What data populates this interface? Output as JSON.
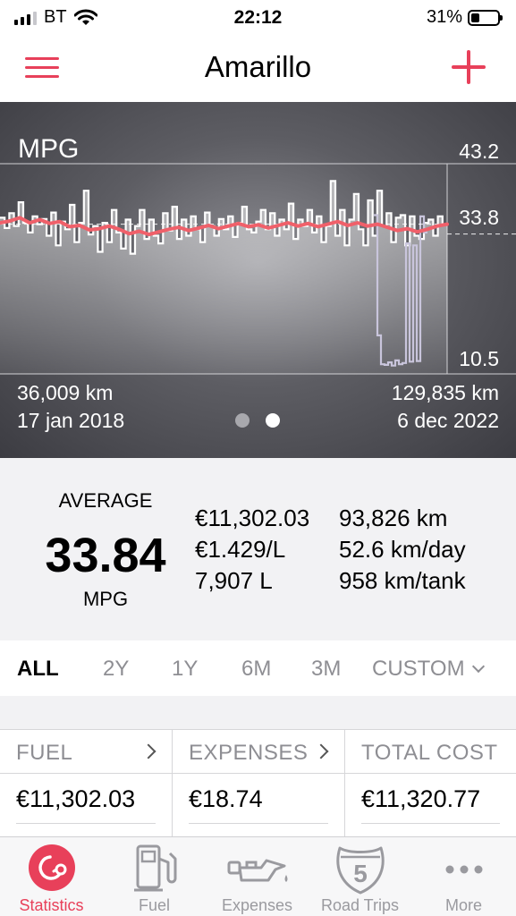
{
  "status_bar": {
    "carrier": "BT",
    "time": "22:12",
    "battery": "31%",
    "battery_level": 0.31
  },
  "navbar": {
    "title": "Amarillo"
  },
  "chart_data": {
    "type": "line",
    "title": "MPG",
    "y_ticks": [
      "43.2",
      "33.8",
      "10.5"
    ],
    "ylim": [
      10.5,
      43.2
    ],
    "average": 33.8,
    "x_start": {
      "distance": "36,009 km",
      "date": "17 jan 2018"
    },
    "x_end": {
      "distance": "129,835 km",
      "date": "6 dec 2022"
    },
    "series": [
      {
        "name": "",
        "color": "#ffffff",
        "values": [
          34.8,
          33.2,
          35.5,
          33.5,
          37.2,
          34.0,
          32.5,
          35.0,
          33.8,
          34.6,
          32.0,
          35.6,
          30.5,
          34.2,
          33.0,
          36.8,
          31.0,
          34.0,
          39.0,
          32.2,
          33.5,
          29.5,
          34.0,
          31.0,
          36.0,
          32.5,
          30.0,
          34.5,
          29.2,
          33.5,
          36.0,
          31.5,
          34.5,
          32.0,
          30.8,
          35.5,
          32.8,
          36.5,
          31.5,
          34.5,
          32.0,
          35.0,
          33.0,
          31.0,
          35.6,
          33.5,
          32.0,
          34.6,
          33.0,
          35.0,
          31.8,
          34.0,
          36.5,
          33.0,
          32.5,
          34.2,
          36.0,
          33.0,
          35.5,
          32.0,
          34.5,
          33.0,
          37.0,
          31.5,
          34.5,
          33.5,
          36.0,
          32.5,
          35.0,
          31.0,
          33.5,
          40.5,
          32.0,
          36.0,
          30.5,
          34.5,
          38.5,
          33.0,
          30.5,
          37.5,
          32.0,
          39.0,
          33.5,
          35.5,
          31.0,
          34.8,
          35.2,
          30.5,
          35.0,
          32.0,
          31.5,
          34.0,
          34.5,
          32.0,
          35.0,
          33.8
        ]
      },
      {
        "name": "",
        "color": "#c9c5dc",
        "values": [
          35.2,
          16.5,
          12.0,
          11.9,
          12.3,
          11.8,
          12.6,
          12.0,
          12.2,
          30.8,
          12.4,
          30.5,
          12.5,
          35.0,
          32.5
        ]
      },
      {
        "name": "",
        "color": "#f0606a",
        "values": [
          34.0,
          34.3,
          34.8,
          34.0,
          34.5,
          33.9,
          34.2,
          33.4,
          33.6,
          32.9,
          33.1,
          33.5,
          33.0,
          32.3,
          32.7,
          32.2,
          32.6,
          33.0,
          33.3,
          32.8,
          33.2,
          33.6,
          33.1,
          33.5,
          33.9,
          33.4,
          33.7,
          33.2,
          33.6,
          34.0,
          33.5,
          33.9,
          33.4,
          33.8,
          34.2,
          33.6,
          34.0,
          33.5,
          33.8,
          33.3,
          32.8,
          33.1,
          32.6,
          33.0,
          33.5,
          33.8
        ]
      }
    ]
  },
  "pager": {
    "pages": 2,
    "active": 2
  },
  "stats": {
    "average_label": "AVERAGE",
    "average_value": "33.84",
    "average_unit": "MPG",
    "col1": [
      "€11,302.03",
      "€1.429/L",
      "7,907 L"
    ],
    "col2": [
      "93,826 km",
      "52.6 km/day",
      "958 km/tank"
    ]
  },
  "ranges": [
    "ALL",
    "2Y",
    "1Y",
    "6M",
    "3M",
    "CUSTOM"
  ],
  "active_range": "ALL",
  "summary": [
    {
      "title": "FUEL",
      "value": "€11,302.03"
    },
    {
      "title": "EXPENSES",
      "value": "€18.74"
    },
    {
      "title": "TOTAL COST",
      "value": "€11,320.77"
    }
  ],
  "tabs": [
    {
      "label": "Statistics",
      "icon": "statistics-icon"
    },
    {
      "label": "Fuel",
      "icon": "fuel-pump-icon"
    },
    {
      "label": "Expenses",
      "icon": "oil-can-icon"
    },
    {
      "label": "Road Trips",
      "icon": "highway-shield-icon",
      "badge": "5"
    },
    {
      "label": "More",
      "icon": "more-dots-icon"
    }
  ],
  "colors": {
    "accent": "#e8405a",
    "tab_inactive": "#9a9a9f",
    "range_inactive": "#8e8e93"
  }
}
